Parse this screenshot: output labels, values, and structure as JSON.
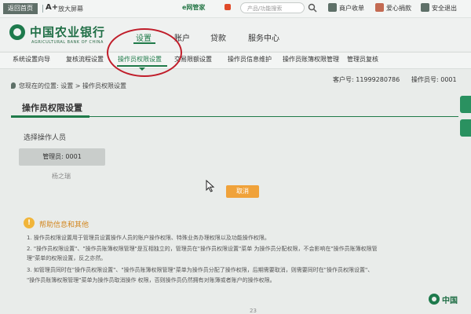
{
  "utility_bar": {
    "return_home": "返回首页",
    "font_icon": "A+",
    "zoom_label": "放大屏幕",
    "security_label": "e网管家",
    "search_placeholder": "产品/功能搜索",
    "links": [
      "商户收单",
      "爱心捐款",
      "安全退出"
    ]
  },
  "header": {
    "bank_name": "中国农业银行",
    "bank_name_en": "AGRICULTURAL BANK OF CHINA",
    "nav": [
      "设置",
      "账户",
      "贷款",
      "服务中心"
    ]
  },
  "subnav": {
    "items": [
      "系统设置向导",
      "复核流程设置",
      "操作员权限设置",
      "交易限额设置",
      "操作员信息维护",
      "操作员账簿权限管理",
      "管理员复核"
    ]
  },
  "location": {
    "breadcrumb": "您现在的位置: 设置 > 操作员权限设置",
    "customer_no": "客户号: 11999280786",
    "operator_no": "操作员号: 0001"
  },
  "main": {
    "section_title": "操作员权限设置",
    "choose_label": "选择操作人员",
    "operator_chip": "管理员: 0001",
    "operator_name": "杨之瑞",
    "cancel_button": "取消"
  },
  "help": {
    "title": "帮助信息和其他",
    "lines": [
      "1.  操作员权限设置用于管理员设置操作人员的账户操作权限、特殊业务办理权限以及功能操作权限。",
      "2.  \"操作员权限设置\"、\"操作员账簿权限管理\"是互相独立的，管理员在\"操作员权限设置\"菜单 为操作员分配权限，不会影响在\"操作员账簿权限管",
      "    理\"菜单的权限设置，反之亦然。",
      "3.  如管理员同时在\"操作员权限设置\"、\"操作员账簿权限管理\"菜单为操作员分配了操作权限，后期需要取消，则需要同时在\"操作员权限设置\"、",
      "    \"操作员账簿权限管理\"菜单为操作员取消操作 权限，否则操作员仍然拥有对账簿或者账户的操作权限。"
    ]
  },
  "footer": {
    "logo_text": "中国",
    "page_number": "23"
  },
  "colors": {
    "brand_green": "#1f7a49",
    "highlight_red": "#c01d2a",
    "button_orange": "#f0a23a"
  }
}
